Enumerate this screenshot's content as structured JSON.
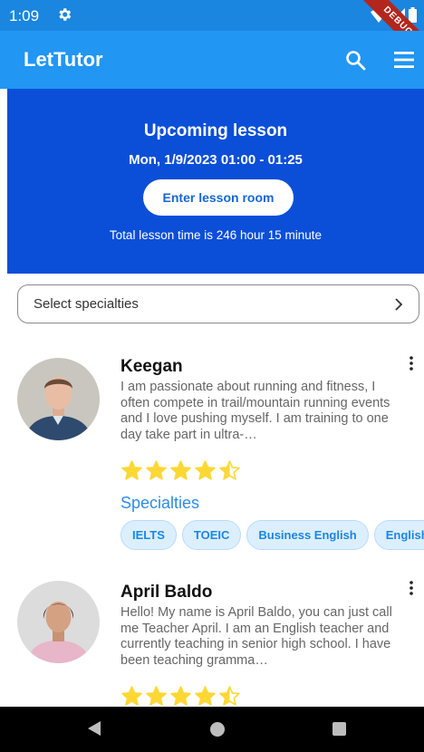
{
  "status_bar": {
    "time": "1:09",
    "debug_label": "DEBUG"
  },
  "app_bar": {
    "title": "LetTutor"
  },
  "upcoming": {
    "title": "Upcoming lesson",
    "date": "Mon, 1/9/2023 01:00 - 01:25",
    "enter_label": "Enter lesson room",
    "total_time": "Total lesson time is  246 hour 15 minute"
  },
  "filter": {
    "label": "Select specialties"
  },
  "tutors": [
    {
      "name": "Keegan",
      "description": "I am passionate about running and fitness, I often compete in trail/mountain running events and I love pushing myself. I am training to one day take part in ultra-…",
      "rating": 4.5,
      "specialties_title": "Specialties",
      "specialties": [
        "IELTS",
        "TOEIC",
        "Business English",
        "English"
      ]
    },
    {
      "name": "April Baldo",
      "description": "Hello! My name is April Baldo, you can just call me Teacher April. I am an English teacher and currently teaching in senior high school. I have been teaching gramma…",
      "rating": 4.5
    }
  ],
  "colors": {
    "primary": "#2196f3",
    "banner": "#0b4fd8",
    "star": "#fdd835",
    "chip_text": "#1b86e3"
  }
}
